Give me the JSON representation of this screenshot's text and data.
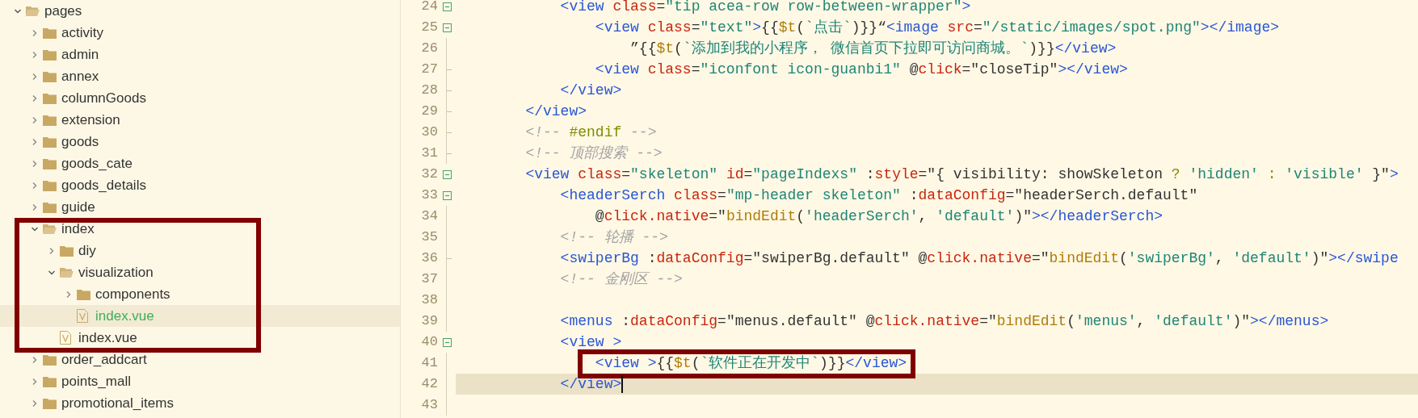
{
  "tree": [
    {
      "name": "pages",
      "kind": "folder",
      "expanded": true,
      "selected": false,
      "boxed": false,
      "children": [
        {
          "name": "activity",
          "kind": "folder",
          "expanded": false,
          "selected": false,
          "boxed": false
        },
        {
          "name": "admin",
          "kind": "folder",
          "expanded": false,
          "selected": false,
          "boxed": false
        },
        {
          "name": "annex",
          "kind": "folder",
          "expanded": false,
          "selected": false,
          "boxed": false
        },
        {
          "name": "columnGoods",
          "kind": "folder",
          "expanded": false,
          "selected": false,
          "boxed": false
        },
        {
          "name": "extension",
          "kind": "folder",
          "expanded": false,
          "selected": false,
          "boxed": false
        },
        {
          "name": "goods",
          "kind": "folder",
          "expanded": false,
          "selected": false,
          "boxed": false
        },
        {
          "name": "goods_cate",
          "kind": "folder",
          "expanded": false,
          "selected": false,
          "boxed": false
        },
        {
          "name": "goods_details",
          "kind": "folder",
          "expanded": false,
          "selected": false,
          "boxed": false
        },
        {
          "name": "guide",
          "kind": "folder",
          "expanded": false,
          "selected": false,
          "boxed": false
        },
        {
          "name": "index",
          "kind": "folder",
          "expanded": true,
          "selected": false,
          "boxed": true,
          "children": [
            {
              "name": "diy",
              "kind": "folder",
              "expanded": false,
              "selected": false,
              "boxed": false
            },
            {
              "name": "visualization",
              "kind": "folder",
              "expanded": true,
              "selected": false,
              "boxed": false,
              "children": [
                {
                  "name": "components",
                  "kind": "folder",
                  "expanded": false,
                  "selected": false,
                  "boxed": false
                },
                {
                  "name": "index.vue",
                  "kind": "file",
                  "selected": true,
                  "boxed": false
                }
              ]
            },
            {
              "name": "index.vue",
              "kind": "file",
              "selected": false,
              "boxed": false
            }
          ]
        },
        {
          "name": "order_addcart",
          "kind": "folder",
          "expanded": false,
          "selected": false,
          "boxed": false
        },
        {
          "name": "points_mall",
          "kind": "folder",
          "expanded": false,
          "selected": false,
          "boxed": false
        },
        {
          "name": "promotional_items",
          "kind": "folder",
          "expanded": false,
          "selected": false,
          "boxed": false
        }
      ]
    }
  ],
  "editor": {
    "lines": [
      {
        "number": "24",
        "foldable": true,
        "fold_end": false,
        "current": false,
        "cursor": false,
        "boxed": false,
        "tokens": [
          {
            "kind": "tag",
            "text": "            <view"
          },
          {
            "kind": "attr",
            "text": " class"
          },
          {
            "kind": "plain",
            "text": "="
          },
          {
            "kind": "str",
            "text": "\"tip acea-row row-between-wrapper\""
          },
          {
            "kind": "tag",
            "text": ">"
          }
        ]
      },
      {
        "number": "25",
        "foldable": true,
        "fold_end": false,
        "current": false,
        "cursor": false,
        "boxed": false,
        "tokens": [
          {
            "kind": "tag",
            "text": "                <view"
          },
          {
            "kind": "attr",
            "text": " class"
          },
          {
            "kind": "plain",
            "text": "="
          },
          {
            "kind": "str",
            "text": "\"text\""
          },
          {
            "kind": "tag",
            "text": ">"
          },
          {
            "kind": "plain",
            "text": "{{"
          },
          {
            "kind": "fn",
            "text": "$t"
          },
          {
            "kind": "plain",
            "text": "("
          },
          {
            "kind": "str",
            "text": "`点击`"
          },
          {
            "kind": "plain",
            "text": ")}}“"
          },
          {
            "kind": "tag",
            "text": "<image"
          },
          {
            "kind": "attr",
            "text": " src"
          },
          {
            "kind": "plain",
            "text": "="
          },
          {
            "kind": "str",
            "text": "\"/static/images/spot.png\""
          },
          {
            "kind": "tag",
            "text": "></image>"
          }
        ]
      },
      {
        "number": "26",
        "foldable": false,
        "fold_end": false,
        "current": false,
        "cursor": false,
        "boxed": false,
        "tokens": [
          {
            "kind": "plain",
            "text": "                    ”{{"
          },
          {
            "kind": "fn",
            "text": "$t"
          },
          {
            "kind": "plain",
            "text": "("
          },
          {
            "kind": "str",
            "text": "`添加到我的小程序， 微信首页下拉即可访问商城。`"
          },
          {
            "kind": "plain",
            "text": ")}}"
          },
          {
            "kind": "tag",
            "text": "</view>"
          }
        ]
      },
      {
        "number": "27",
        "foldable": false,
        "fold_end": true,
        "current": false,
        "cursor": false,
        "boxed": false,
        "tokens": [
          {
            "kind": "tag",
            "text": "                <view"
          },
          {
            "kind": "attr",
            "text": " class"
          },
          {
            "kind": "plain",
            "text": "="
          },
          {
            "kind": "str",
            "text": "\"iconfont icon-guanbi1\""
          },
          {
            "kind": "plain",
            "text": " @"
          },
          {
            "kind": "attr",
            "text": "click"
          },
          {
            "kind": "plain",
            "text": "=\"closeTip\""
          },
          {
            "kind": "tag",
            "text": "></view>"
          }
        ]
      },
      {
        "number": "28",
        "foldable": false,
        "fold_end": true,
        "current": false,
        "cursor": false,
        "boxed": false,
        "tokens": [
          {
            "kind": "tag",
            "text": "            </view>"
          }
        ]
      },
      {
        "number": "29",
        "foldable": false,
        "fold_end": true,
        "current": false,
        "cursor": false,
        "boxed": false,
        "tokens": [
          {
            "kind": "tag",
            "text": "        </view>"
          }
        ]
      },
      {
        "number": "30",
        "foldable": false,
        "fold_end": true,
        "current": false,
        "cursor": false,
        "boxed": false,
        "tokens": [
          {
            "kind": "comment",
            "text": "        <!-- "
          },
          {
            "kind": "dir",
            "text": "#endif"
          },
          {
            "kind": "comment",
            "text": " -->"
          }
        ]
      },
      {
        "number": "31",
        "foldable": false,
        "fold_end": true,
        "current": false,
        "cursor": false,
        "boxed": false,
        "tokens": [
          {
            "kind": "comment",
            "text": "        <!-- 顶部搜索 -->"
          }
        ]
      },
      {
        "number": "32",
        "foldable": true,
        "fold_end": false,
        "current": false,
        "cursor": false,
        "boxed": false,
        "tokens": [
          {
            "kind": "tag",
            "text": "        <view"
          },
          {
            "kind": "attr",
            "text": " class"
          },
          {
            "kind": "plain",
            "text": "="
          },
          {
            "kind": "str",
            "text": "\"skeleton\""
          },
          {
            "kind": "attr",
            "text": " id"
          },
          {
            "kind": "plain",
            "text": "="
          },
          {
            "kind": "str",
            "text": "\"pageIndexs\""
          },
          {
            "kind": "plain",
            "text": " :"
          },
          {
            "kind": "attr",
            "text": "style"
          },
          {
            "kind": "plain",
            "text": "=\"{ visibility: showSkeleton "
          },
          {
            "kind": "dir",
            "text": "?"
          },
          {
            "kind": "str",
            "text": " 'hidden'"
          },
          {
            "kind": "dir",
            "text": " :"
          },
          {
            "kind": "str",
            "text": " 'visible'"
          },
          {
            "kind": "plain",
            "text": " }\""
          },
          {
            "kind": "tag",
            "text": ">"
          }
        ]
      },
      {
        "number": "33",
        "foldable": true,
        "fold_end": false,
        "current": false,
        "cursor": false,
        "boxed": false,
        "tokens": [
          {
            "kind": "tag",
            "text": "            <headerSerch"
          },
          {
            "kind": "attr",
            "text": " class"
          },
          {
            "kind": "plain",
            "text": "="
          },
          {
            "kind": "str",
            "text": "\"mp-header skeleton\""
          },
          {
            "kind": "plain",
            "text": " :"
          },
          {
            "kind": "attr",
            "text": "dataConfig"
          },
          {
            "kind": "plain",
            "text": "=\"headerSerch.default\""
          }
        ]
      },
      {
        "number": "34",
        "foldable": false,
        "fold_end": false,
        "current": false,
        "cursor": false,
        "boxed": false,
        "tokens": [
          {
            "kind": "plain",
            "text": "                @"
          },
          {
            "kind": "attr",
            "text": "click.native"
          },
          {
            "kind": "plain",
            "text": "=\""
          },
          {
            "kind": "fn",
            "text": "bindEdit"
          },
          {
            "kind": "plain",
            "text": "("
          },
          {
            "kind": "str",
            "text": "'headerSerch'"
          },
          {
            "kind": "plain",
            "text": ","
          },
          {
            "kind": "str",
            "text": " 'default'"
          },
          {
            "kind": "plain",
            "text": ")\""
          },
          {
            "kind": "tag",
            "text": "></headerSerch>"
          }
        ]
      },
      {
        "number": "35",
        "foldable": false,
        "fold_end": false,
        "current": false,
        "cursor": false,
        "boxed": false,
        "tokens": [
          {
            "kind": "comment",
            "text": "            <!-- 轮播 -->"
          }
        ]
      },
      {
        "number": "36",
        "foldable": false,
        "fold_end": true,
        "current": false,
        "cursor": false,
        "boxed": false,
        "tokens": [
          {
            "kind": "tag",
            "text": "            <swiperBg"
          },
          {
            "kind": "plain",
            "text": " :"
          },
          {
            "kind": "attr",
            "text": "dataConfig"
          },
          {
            "kind": "plain",
            "text": "=\"swiperBg.default\" @"
          },
          {
            "kind": "attr",
            "text": "click.native"
          },
          {
            "kind": "plain",
            "text": "=\""
          },
          {
            "kind": "fn",
            "text": "bindEdit"
          },
          {
            "kind": "plain",
            "text": "("
          },
          {
            "kind": "str",
            "text": "'swiperBg'"
          },
          {
            "kind": "plain",
            "text": ","
          },
          {
            "kind": "str",
            "text": " 'default'"
          },
          {
            "kind": "plain",
            "text": ")\""
          },
          {
            "kind": "tag",
            "text": "></swipe"
          }
        ]
      },
      {
        "number": "37",
        "foldable": false,
        "fold_end": false,
        "current": false,
        "cursor": false,
        "boxed": false,
        "tokens": [
          {
            "kind": "comment",
            "text": "            <!-- 金刚区 -->"
          }
        ]
      },
      {
        "number": "38",
        "foldable": false,
        "fold_end": false
      },
      {
        "number": "39",
        "foldable": false,
        "fold_end": false,
        "current": false,
        "cursor": false,
        "boxed": false,
        "tokens": [
          {
            "kind": "tag",
            "text": "            <menus"
          },
          {
            "kind": "plain",
            "text": " :"
          },
          {
            "kind": "attr",
            "text": "dataConfig"
          },
          {
            "kind": "plain",
            "text": "=\"menus.default\" @"
          },
          {
            "kind": "attr",
            "text": "click.native"
          },
          {
            "kind": "plain",
            "text": "=\""
          },
          {
            "kind": "fn",
            "text": "bindEdit"
          },
          {
            "kind": "plain",
            "text": "("
          },
          {
            "kind": "str",
            "text": "'menus'"
          },
          {
            "kind": "plain",
            "text": ","
          },
          {
            "kind": "str",
            "text": " 'default'"
          },
          {
            "kind": "plain",
            "text": ")\""
          },
          {
            "kind": "tag",
            "text": "></menus>"
          }
        ]
      },
      {
        "number": "40",
        "foldable": true,
        "fold_end": false,
        "current": false,
        "cursor": false,
        "boxed": false,
        "tokens": [
          {
            "kind": "tag",
            "text": "            <view >"
          }
        ]
      },
      {
        "number": "41",
        "foldable": false,
        "fold_end": false,
        "current": false,
        "cursor": false,
        "boxed": true,
        "tokens": [
          {
            "kind": "tag",
            "text": "                <view >"
          },
          {
            "kind": "plain",
            "text": "{{"
          },
          {
            "kind": "fn",
            "text": "$t"
          },
          {
            "kind": "plain",
            "text": "("
          },
          {
            "kind": "str",
            "text": "`软件正在开发中`"
          },
          {
            "kind": "plain",
            "text": ")}}"
          },
          {
            "kind": "tag",
            "text": "</view>"
          }
        ]
      },
      {
        "number": "42",
        "foldable": false,
        "fold_end": false,
        "current": true,
        "cursor": true,
        "boxed": false,
        "tokens": [
          {
            "kind": "tag",
            "text": "            </view>"
          }
        ]
      },
      {
        "number": "43",
        "foldable": false,
        "fold_end": false
      }
    ]
  }
}
